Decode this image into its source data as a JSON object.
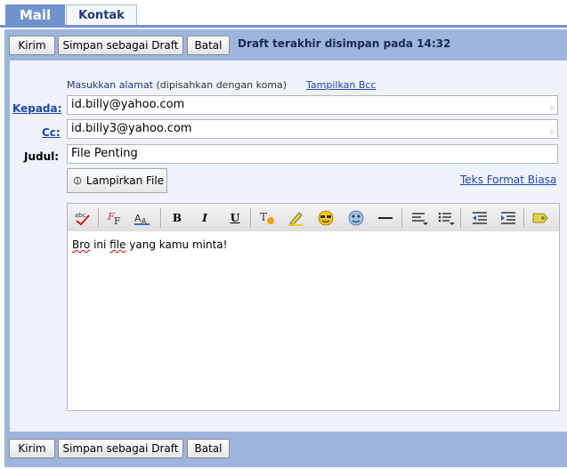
{
  "tabs": {
    "mail": "Mail",
    "kontak": "Kontak"
  },
  "actions": {
    "send": "Kirim",
    "save_draft": "Simpan sebagai Draft",
    "cancel": "Batal",
    "draft_status": "Draft terakhir disimpan pada 14:32"
  },
  "compose": {
    "hint_prefix": "Masukkan alamat",
    "hint_suffix": " (dipisahkan dengan koma)",
    "show_bcc": "Tampilkan Bcc",
    "to_label": "Kepada:",
    "to_value": "id.billy@yahoo.com",
    "cc_label": "Cc:",
    "cc_value": "id.billy3@yahoo.com",
    "subject_label": "Judul:",
    "subject_value": "File Penting",
    "attach_label": "Lampirkan File",
    "plain_text_link": "Teks Format Biasa"
  },
  "toolbar": [
    "spellcheck-icon",
    "font-face-icon",
    "font-size-icon",
    "bold-icon",
    "italic-icon",
    "underline-icon",
    "text-color-icon",
    "highlight-icon",
    "emoticon-icon",
    "smiley-sticker-icon",
    "horizontal-rule-icon",
    "align-icon",
    "list-icon",
    "outdent-icon",
    "indent-icon",
    "insert-link-icon"
  ],
  "body": {
    "word1": "Bro",
    "mid1": " ini ",
    "word2": "file",
    "mid2": " yang kamu minta!"
  }
}
